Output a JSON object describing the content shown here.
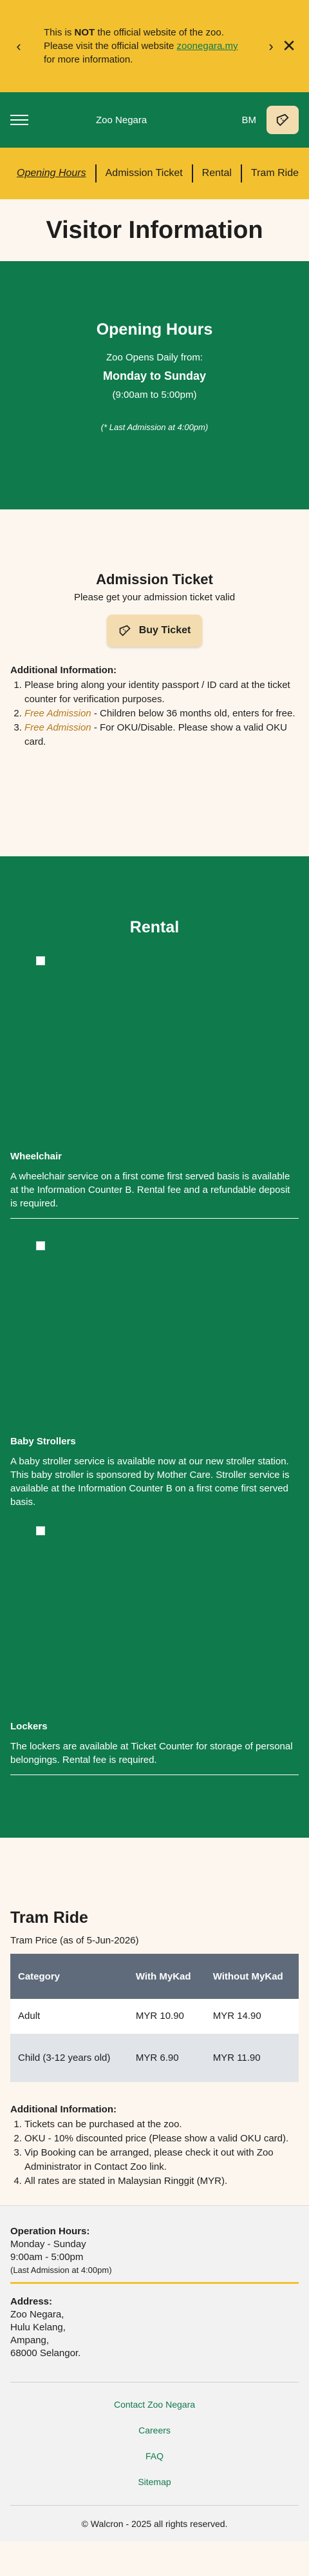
{
  "notice": {
    "pre": "This is",
    "bold": "NOT",
    "mid": "the official website of the zoo. Please visit the official website",
    "link": "zoonegara.my",
    "post": "for more information."
  },
  "header": {
    "brand": "Zoo Negara",
    "language": "BM"
  },
  "tabs": [
    "Opening Hours",
    "Admission Ticket",
    "Rental",
    "Tram Ride"
  ],
  "page_title": "Visitor Information",
  "hours": {
    "title": "Opening Hours",
    "line1": "Zoo Opens Daily from:",
    "days": "Monday to Sunday",
    "time": "(9:00am to 5:00pm)",
    "last": "(* Last Admission at 4:00pm)"
  },
  "admission": {
    "title": "Admission Ticket",
    "subtitle": "Please get your admission ticket valid",
    "buy_label": "Buy Ticket",
    "info_title": "Additional Information:",
    "item1": "Please bring along your identity passport / ID card at the ticket counter for verification purposes.",
    "item2_hl": "Free Admission",
    "item2_rest": "- Children below 36 months old, enters for free.",
    "item3_hl": "Free Admission",
    "item3_rest": "- For OKU/Disable. Please show a valid OKU card."
  },
  "rental": {
    "title": "Rental",
    "items": [
      {
        "name": "Wheelchair",
        "desc": "A wheelchair service on a first come first served basis is available at the Information Counter B. Rental fee and a refundable deposit is required."
      },
      {
        "name": "Baby Strollers",
        "desc": "A baby stroller service is available now at our new stroller station. This baby stroller is sponsored by Mother Care. Stroller service is available at the Information Counter B on a first come first served basis."
      },
      {
        "name": "Lockers",
        "desc": "The lockers are available at Ticket Counter for storage of personal belongings. Rental fee is required."
      }
    ]
  },
  "tram": {
    "title": "Tram Ride",
    "price_note": "Tram Price (as of 5-Jun-2026)",
    "headers": [
      "Category",
      "With MyKad",
      "Without MyKad"
    ],
    "rows": [
      [
        "Adult",
        "MYR 10.90",
        "MYR 14.90"
      ],
      [
        "Child (3-12 years old)",
        "MYR 6.90",
        "MYR 11.90"
      ]
    ],
    "info_title": "Additional Information:",
    "notes": [
      "Tickets can be purchased at the zoo.",
      "OKU - 10% discounted price (Please show a valid OKU card).",
      "Vip Booking can be arranged, please check it out with Zoo Administrator in Contact Zoo link.",
      "All rates are stated in Malaysian Ringgit (MYR)."
    ]
  },
  "footer": {
    "hours_title": "Operation Hours:",
    "hours_days": "Monday - Sunday",
    "hours_time": "9:00am - 5:00pm",
    "hours_last": "(Last Admission at 4:00pm)",
    "addr_title": "Address:",
    "addr1": "Zoo Negara,",
    "addr2": "Hulu Kelang,",
    "addr3": "Ampang,",
    "addr4": "68000 Selangor.",
    "links": [
      "Contact Zoo Negara",
      "Careers",
      "FAQ",
      "Sitemap"
    ],
    "copyright": "© Walcron - 2025 all rights reserved."
  }
}
